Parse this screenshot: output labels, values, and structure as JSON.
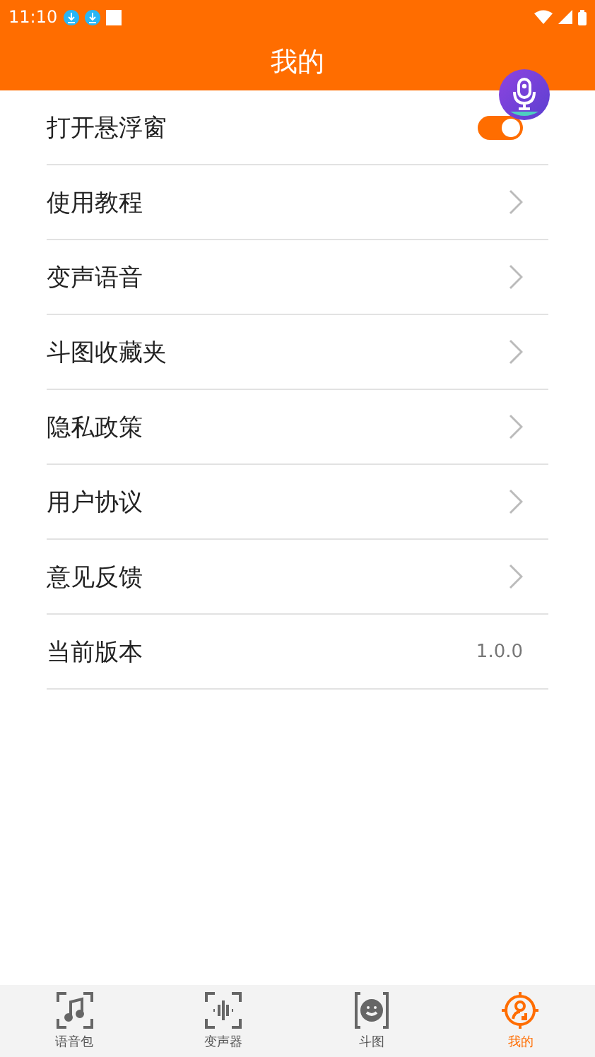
{
  "status_bar": {
    "time": "11:10"
  },
  "header": {
    "title": "我的"
  },
  "settings": [
    {
      "kind": "toggle",
      "label": "打开悬浮窗",
      "on": true
    },
    {
      "kind": "link",
      "label": "使用教程"
    },
    {
      "kind": "link",
      "label": "变声语音"
    },
    {
      "kind": "link",
      "label": "斗图收藏夹"
    },
    {
      "kind": "link",
      "label": "隐私政策"
    },
    {
      "kind": "link",
      "label": "用户协议"
    },
    {
      "kind": "link",
      "label": "意见反馈"
    },
    {
      "kind": "value",
      "label": "当前版本",
      "value": "1.0.0"
    }
  ],
  "bottom_nav": [
    {
      "label": "语音包",
      "kind": "music",
      "selected": false
    },
    {
      "label": "变声器",
      "kind": "wave",
      "selected": false
    },
    {
      "label": "斗图",
      "kind": "face",
      "selected": false
    },
    {
      "label": "我的",
      "kind": "person",
      "selected": true
    }
  ]
}
